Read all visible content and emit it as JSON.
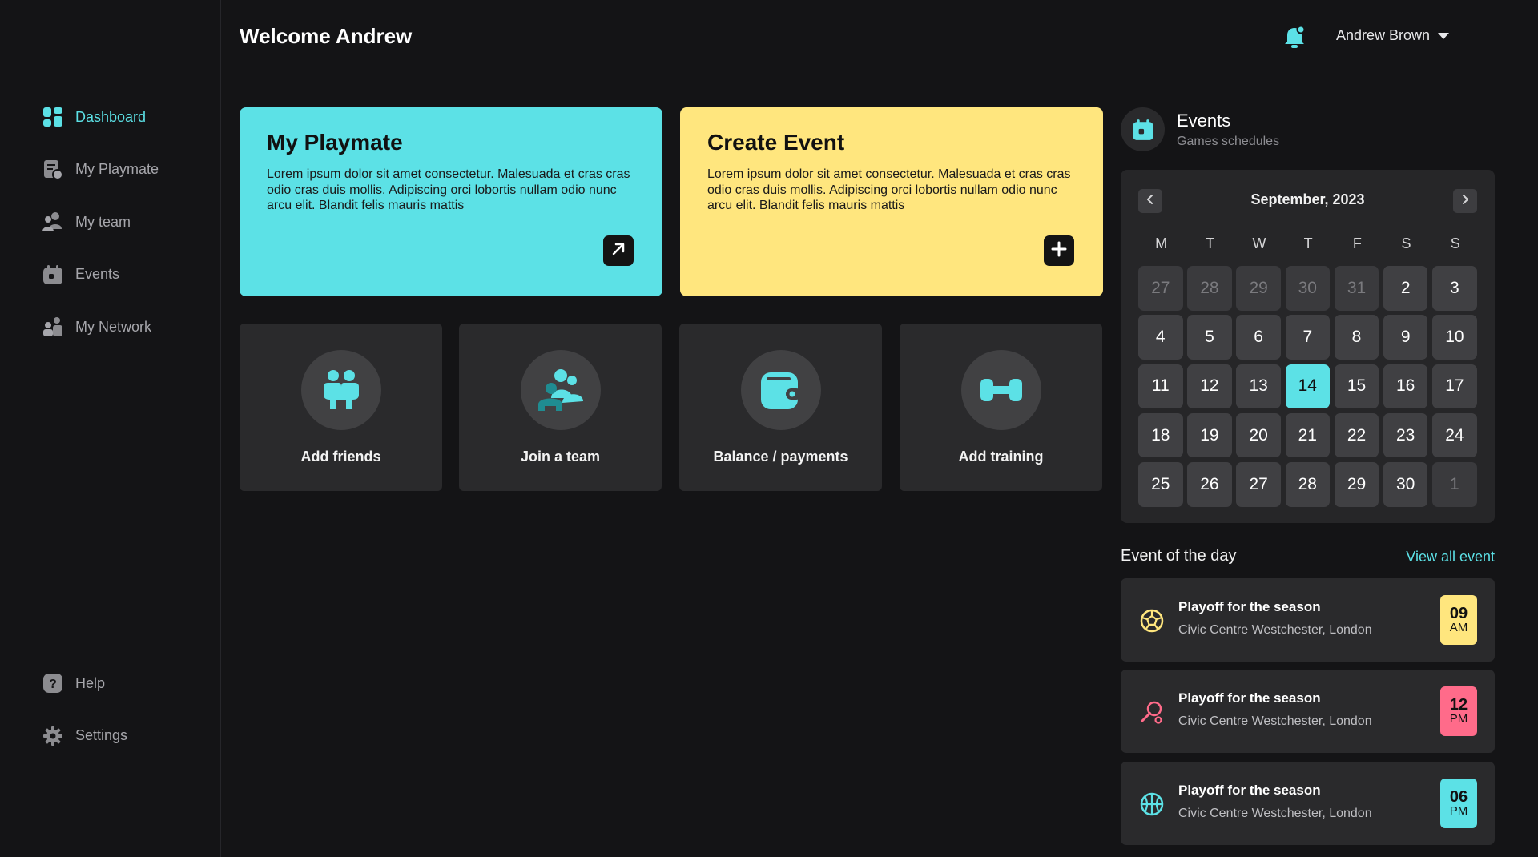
{
  "header": {
    "welcome": "Welcome Andrew",
    "user_name": "Andrew Brown",
    "bell_icon": "bell-icon"
  },
  "colors": {
    "accent": "#5ce1e6",
    "yellow": "#ffe67e",
    "pink": "#ff6b8a",
    "background": "#141416",
    "card": "#2a2a2c"
  },
  "sidebar": {
    "items": [
      {
        "label": "Dashboard",
        "icon": "dashboard-icon",
        "active": true
      },
      {
        "label": "My Playmate",
        "icon": "playmate-icon"
      },
      {
        "label": "My team",
        "icon": "team-icon"
      },
      {
        "label": "Events",
        "icon": "calendar-icon"
      },
      {
        "label": "My Network",
        "icon": "network-icon"
      }
    ],
    "bottom": [
      {
        "label": "Help",
        "icon": "help-icon"
      },
      {
        "label": "Settings",
        "icon": "gear-icon"
      }
    ]
  },
  "cards": {
    "playmate": {
      "title": "My Playmate",
      "text": "Lorem ipsum dolor sit amet consectetur. Malesuada et cras cras odio cras duis mollis. Adipiscing orci lobortis nullam odio nunc arcu elit. Blandit felis mauris mattis"
    },
    "create_event": {
      "title": "Create Event",
      "text": "Lorem ipsum dolor sit amet consectetur. Malesuada et cras cras odio cras duis mollis. Adipiscing orci lobortis nullam odio nunc arcu elit. Blandit felis mauris mattis"
    }
  },
  "tiles": [
    {
      "label": "Add friends",
      "icon": "friends-icon"
    },
    {
      "label": "Join a team",
      "icon": "join-team-icon"
    },
    {
      "label": "Balance / payments",
      "icon": "wallet-icon"
    },
    {
      "label": "Add training",
      "icon": "dumbbell-icon"
    }
  ],
  "events": {
    "title": "Events",
    "subtitle": "Games schedules",
    "calendar": {
      "month": "September, 2023",
      "weekdays": [
        "M",
        "T",
        "W",
        "T",
        "F",
        "S",
        "S"
      ],
      "days": [
        {
          "d": "27",
          "muted": true
        },
        {
          "d": "28",
          "muted": true
        },
        {
          "d": "29",
          "muted": true
        },
        {
          "d": "30",
          "muted": true
        },
        {
          "d": "31",
          "muted": true
        },
        {
          "d": "2"
        },
        {
          "d": "3"
        },
        {
          "d": "4"
        },
        {
          "d": "5"
        },
        {
          "d": "6"
        },
        {
          "d": "7"
        },
        {
          "d": "8"
        },
        {
          "d": "9"
        },
        {
          "d": "10"
        },
        {
          "d": "11"
        },
        {
          "d": "12"
        },
        {
          "d": "13"
        },
        {
          "d": "14",
          "selected": true
        },
        {
          "d": "15"
        },
        {
          "d": "16"
        },
        {
          "d": "17"
        },
        {
          "d": "18"
        },
        {
          "d": "19"
        },
        {
          "d": "20"
        },
        {
          "d": "21"
        },
        {
          "d": "22"
        },
        {
          "d": "23"
        },
        {
          "d": "24"
        },
        {
          "d": "25"
        },
        {
          "d": "26"
        },
        {
          "d": "27"
        },
        {
          "d": "28"
        },
        {
          "d": "29"
        },
        {
          "d": "30"
        },
        {
          "d": "1",
          "muted": true
        }
      ]
    },
    "event_of_day": "Event of the day",
    "view_all": "View all event",
    "list": [
      {
        "title": "Playoff for the season",
        "location": "Civic Centre Westchester, London",
        "hour": "09",
        "period": "AM",
        "icon": "soccer-ball-icon",
        "color": "#ffe67e"
      },
      {
        "title": "Playoff for the season",
        "location": "Civic Centre Westchester, London",
        "hour": "12",
        "period": "PM",
        "icon": "tennis-racket-icon",
        "color": "#ff6b8a"
      },
      {
        "title": "Playoff for the season",
        "location": "Civic Centre Westchester, London",
        "hour": "06",
        "period": "PM",
        "icon": "basketball-icon",
        "color": "#5ce1e6"
      }
    ]
  }
}
